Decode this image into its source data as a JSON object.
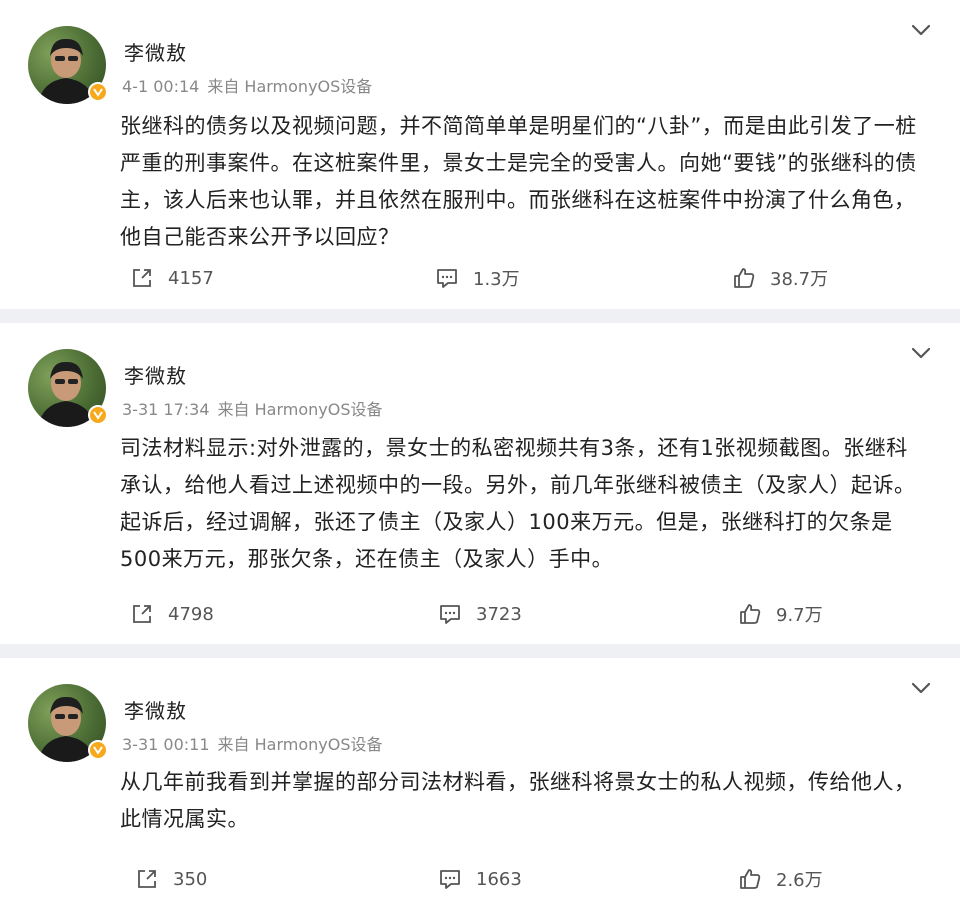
{
  "posts": [
    {
      "username": "李微敖",
      "time": "4-1 00:14",
      "source": "来自 HarmonyOS设备",
      "text": "张继科的债务以及视频问题，并不简简单单是明星们的“八卦”，而是由此引发了一桩严重的刑事案件。在这桩案件里，景女士是完全的受害人。向她“要钱”的张继科的债主，该人后来也认罪，并且依然在服刑中。而张继科在这桩案件中扮演了什么角色，他自己能否来公开予以回应？",
      "repost_count": "4157",
      "comment_count": "1.3万",
      "like_count": "38.7万"
    },
    {
      "username": "李微敖",
      "time": "3-31 17:34",
      "source": "来自 HarmonyOS设备",
      "text": "司法材料显示:对外泄露的，景女士的私密视频共有3条，还有1张视频截图。张继科承认，给他人看过上述视频中的一段。另外，前几年张继科被债主（及家人）起诉。起诉后，经过调解，张还了债主（及家人）100来万元。但是，张继科打的欠条是500来万元，那张欠条，还在债主（及家人）手中。",
      "repost_count": "4798",
      "comment_count": "3723",
      "like_count": "9.7万"
    },
    {
      "username": "李微敖",
      "time": "3-31 00:11",
      "source": "来自 HarmonyOS设备",
      "text": "从几年前我看到并掌握的部分司法材料看，张继科将景女士的私人视频，传给他人，此情况属实。",
      "repost_count": "350",
      "comment_count": "1663",
      "like_count": "2.6万"
    }
  ],
  "icons": {
    "repost": "repost-icon",
    "comment": "comment-icon",
    "like": "like-icon",
    "menu": "chevron-down-icon",
    "verified": "verified-badge-icon"
  },
  "colors": {
    "badge": "#f7a81b",
    "text": "#222222",
    "meta": "#888888",
    "background": "#eef0f3"
  }
}
